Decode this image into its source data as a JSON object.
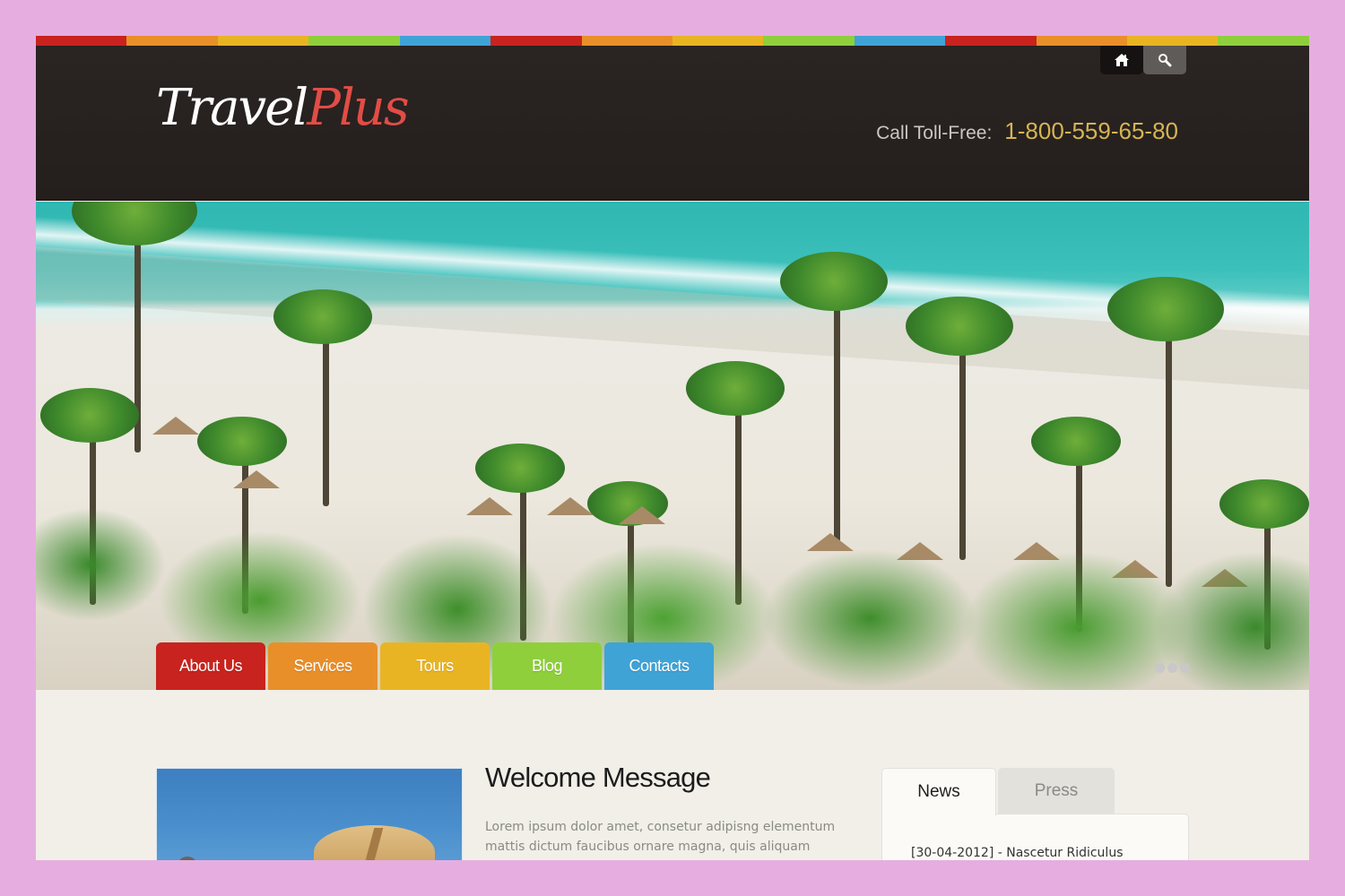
{
  "colors": {
    "red": "#c8231e",
    "orange": "#e88f2a",
    "yellow": "#e9b424",
    "green": "#8fcf3b",
    "blue": "#3fa3d6",
    "header_bg": "#272120",
    "phone_accent": "#d6b453",
    "logo_accent": "#e24c46"
  },
  "stripe": [
    "red",
    "orange",
    "yellow",
    "green",
    "blue",
    "red",
    "orange",
    "yellow",
    "green",
    "blue",
    "red",
    "orange",
    "yellow",
    "green"
  ],
  "header": {
    "logo": {
      "part1": "Travel",
      "part2": "Plus"
    },
    "top_buttons": [
      {
        "icon": "home-icon",
        "label": "Home"
      },
      {
        "icon": "search-icon",
        "label": "Search"
      }
    ],
    "phone_label": "Call Toll-Free:",
    "phone_number": "1-800-559-65-80"
  },
  "nav": [
    {
      "label": "About Us",
      "color": "#c8231e"
    },
    {
      "label": "Services",
      "color": "#e88f2a"
    },
    {
      "label": "Tours",
      "color": "#e9b424"
    },
    {
      "label": "Blog",
      "color": "#8fcf3b"
    },
    {
      "label": "Contacts",
      "color": "#3fa3d6"
    }
  ],
  "slider": {
    "slide_count": 3
  },
  "welcome": {
    "title": "Welcome Message",
    "text": "Lorem ipsum dolor amet, consetur adipisng elementum mattis dictum faucibus ornare magna, quis aliquam"
  },
  "sidebar_tabs": {
    "tabs": [
      {
        "label": "News",
        "active": true
      },
      {
        "label": "Press",
        "active": false
      }
    ],
    "news": [
      {
        "text": "[30-04-2012] - Nascetur Ridiculus"
      }
    ]
  }
}
